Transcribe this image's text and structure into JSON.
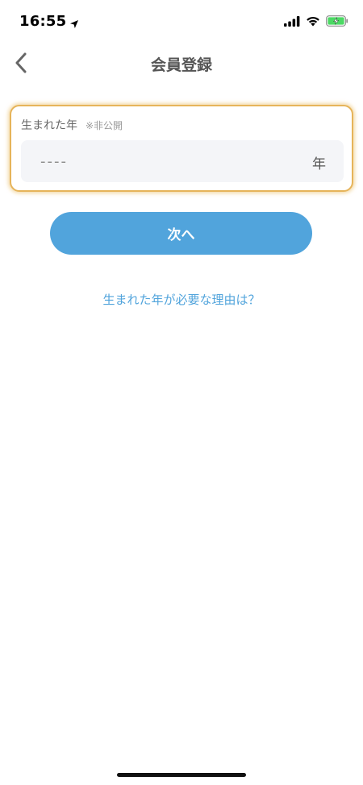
{
  "status_bar": {
    "time": "16:55",
    "icons": [
      "location-arrow-icon",
      "cellular-signal-icon",
      "wifi-icon",
      "battery-charging-icon"
    ],
    "battery_color": "#4cd964"
  },
  "nav": {
    "title": "会員登録",
    "back_icon": "chevron-left-icon"
  },
  "form": {
    "label": "生まれた年",
    "note": "※非公開",
    "year_input": {
      "value": "",
      "placeholder": "----"
    },
    "unit": "年"
  },
  "actions": {
    "next_label": "次へ",
    "reason_link": "生まれた年が必要な理由は？"
  },
  "colors": {
    "accent": "#51a4dc",
    "focus_border": "#e6b45a",
    "input_bg": "#f4f5f8"
  }
}
